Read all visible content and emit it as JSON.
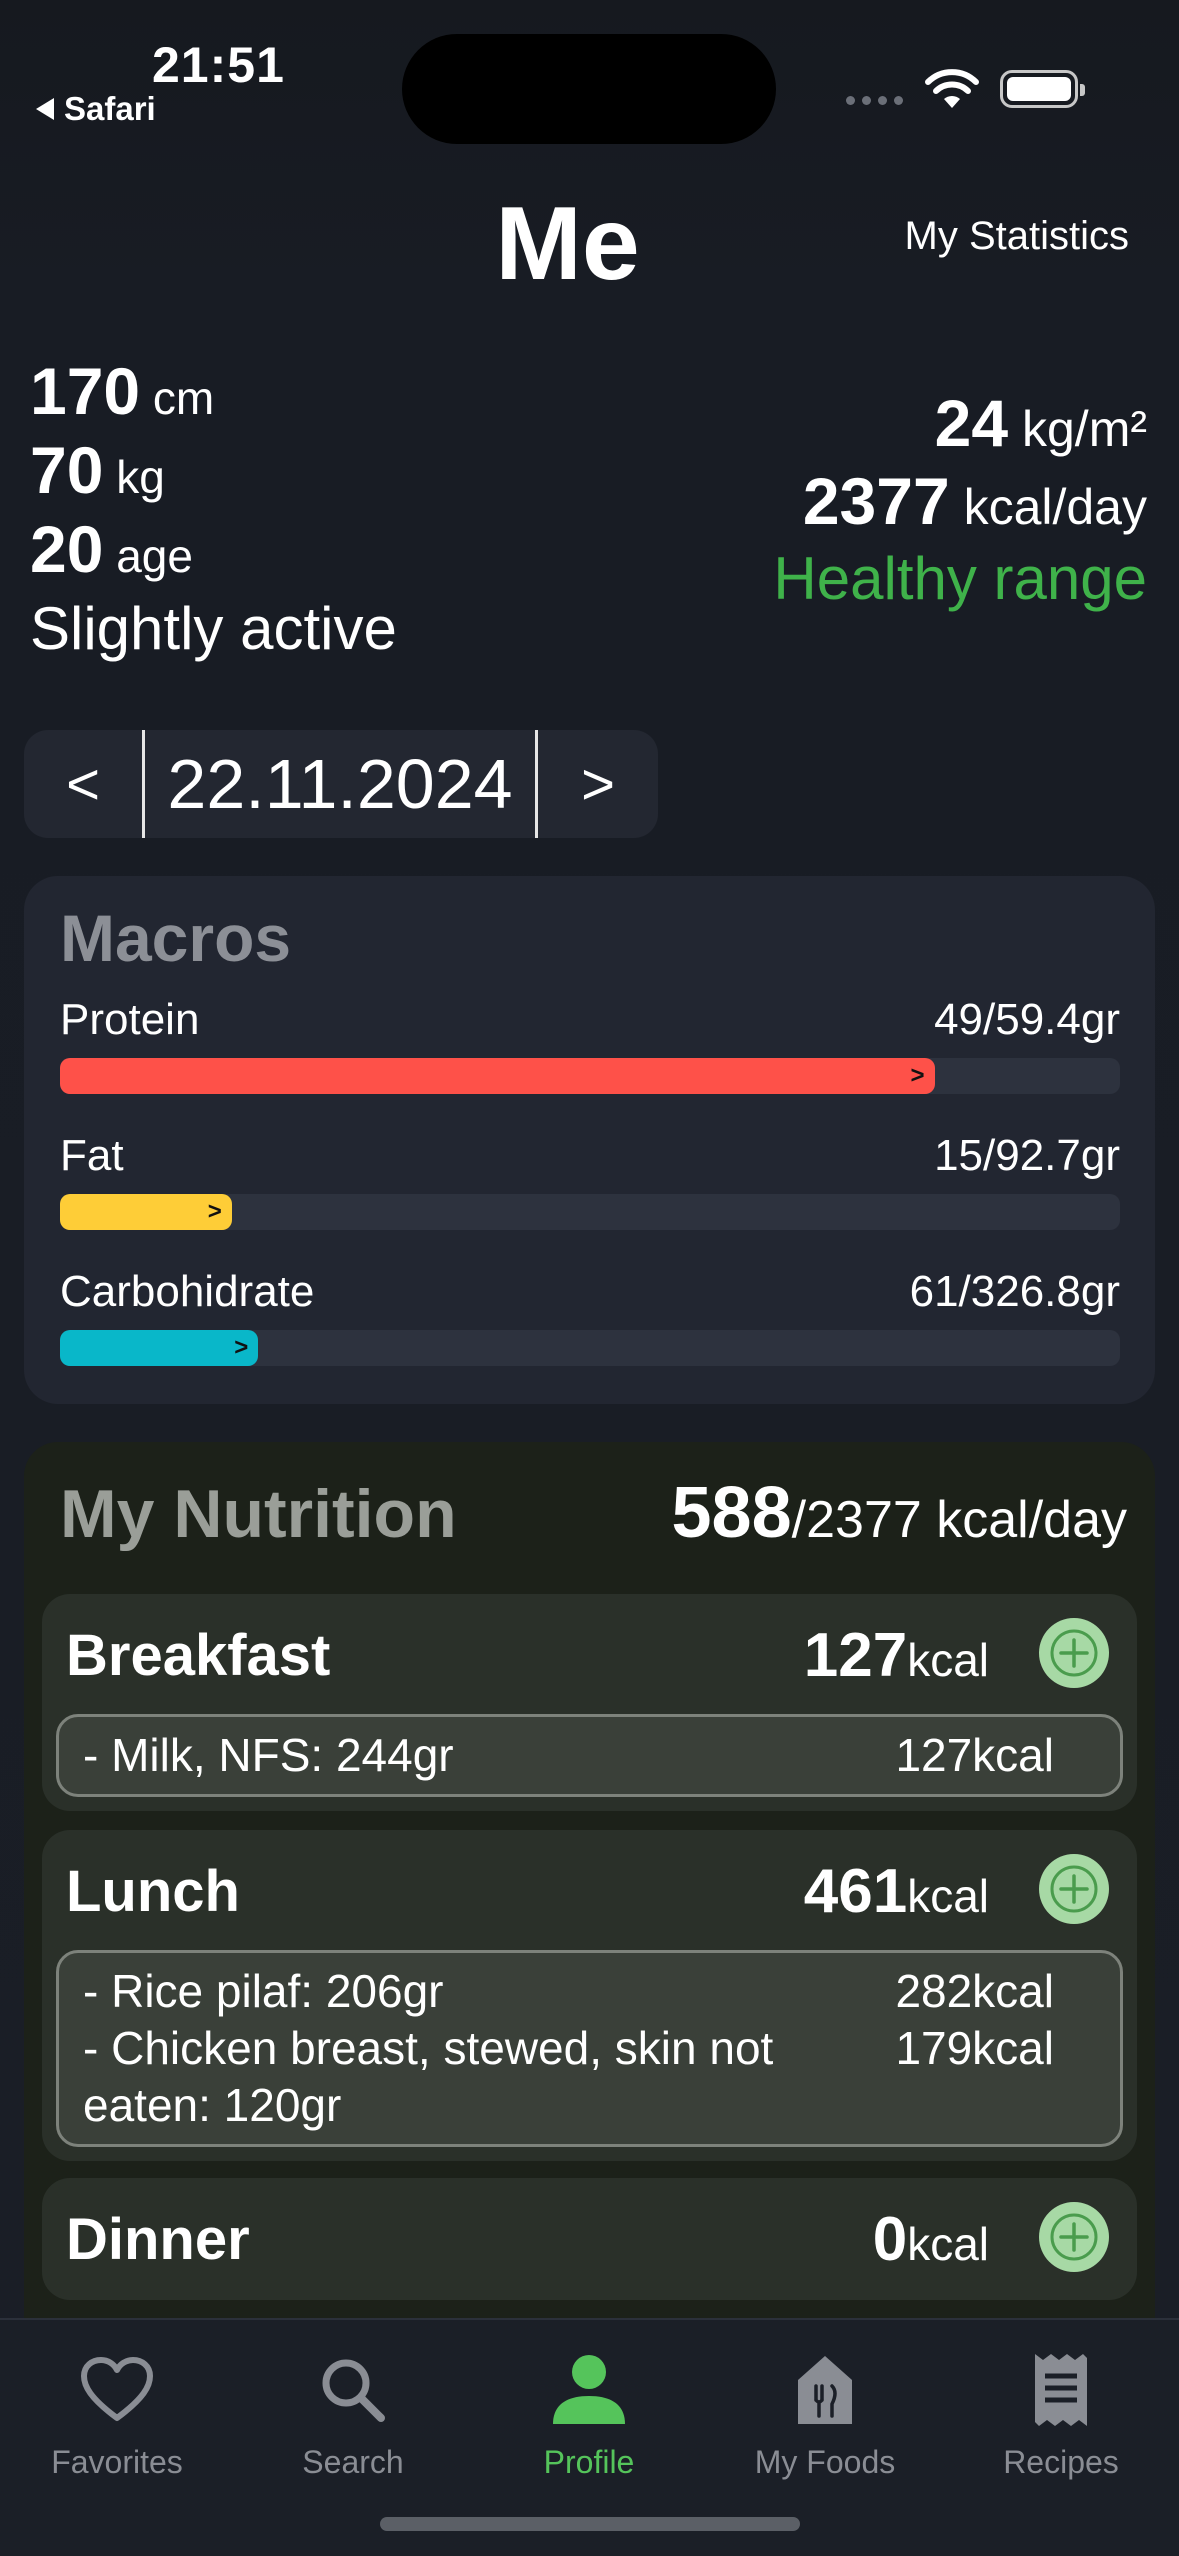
{
  "status": {
    "time": "21:51",
    "back_app": "Safari"
  },
  "header": {
    "title": "Me",
    "stats_link": "My Statistics"
  },
  "profile": {
    "height_value": "170",
    "height_unit": "cm",
    "weight_value": "70",
    "weight_unit": "kg",
    "age_value": "20",
    "age_unit": "age",
    "activity": "Slightly active",
    "bmi_value": "24",
    "bmi_unit": "kg/m²",
    "calories_value": "2377",
    "calories_unit": "kcal/day",
    "range_label": "Healthy range"
  },
  "date_picker": {
    "prev": "<",
    "date": "22.11.2024",
    "next": ">"
  },
  "macros": {
    "title": "Macros",
    "items": [
      {
        "name": "Protein",
        "amount": "49/59.4gr",
        "progress": 0.825,
        "color": "#fe5149",
        "arrow": ">"
      },
      {
        "name": "Fat",
        "amount": "15/92.7gr",
        "progress": 0.162,
        "color": "#fecd37",
        "arrow": ">"
      },
      {
        "name": "Carbohidrate",
        "amount": "61/326.8gr",
        "progress": 0.187,
        "color": "#09b7c9",
        "arrow": ">"
      }
    ]
  },
  "nutrition": {
    "title": "My Nutrition",
    "consumed": "588",
    "target": "/2377 kcal/day",
    "meals": [
      {
        "name": "Breakfast",
        "kcal_value": "127",
        "kcal_unit": "kcal",
        "entries": [
          {
            "food": "- Milk, NFS:  244gr",
            "kcal": "127kcal"
          }
        ]
      },
      {
        "name": "Lunch",
        "kcal_value": "461",
        "kcal_unit": "kcal",
        "entries": [
          {
            "food": "- Rice pilaf:  206gr",
            "kcal": "282kcal"
          },
          {
            "food": "- Chicken breast, stewed, skin not eaten:  120gr",
            "kcal": "179kcal"
          }
        ]
      },
      {
        "name": "Dinner",
        "kcal_value": "0",
        "kcal_unit": "kcal",
        "entries": []
      }
    ]
  },
  "tabbar": {
    "tabs": [
      {
        "label": "Favorites",
        "icon": "heart-icon"
      },
      {
        "label": "Search",
        "icon": "search-icon"
      },
      {
        "label": "Profile",
        "icon": "person-icon",
        "active": true
      },
      {
        "label": "My Foods",
        "icon": "food-box-icon"
      },
      {
        "label": "Recipes",
        "icon": "receipt-icon"
      }
    ],
    "active_color": "#55c45b"
  }
}
